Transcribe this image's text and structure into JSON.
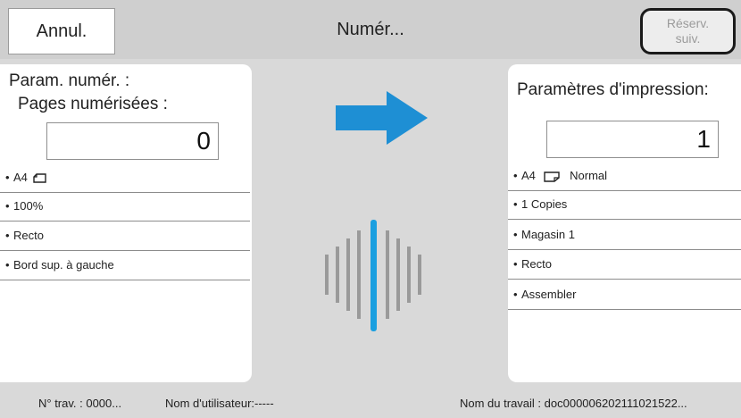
{
  "header": {
    "cancel_label": "Annul.",
    "title": "Numér...",
    "reserve_label": "Réserv.\nsuiv."
  },
  "scan_panel": {
    "title": "Param. numér. :",
    "subtitle": "Pages numérisées :",
    "count": "0",
    "items": [
      {
        "label": "A4",
        "icon": "landscape-page-icon"
      },
      {
        "label": "100%"
      },
      {
        "label": "Recto"
      },
      {
        "label": "Bord sup. à gauche"
      }
    ]
  },
  "print_panel": {
    "title": "Paramètres d'impression:",
    "count": "1",
    "items": [
      {
        "label": "A4",
        "icon": "portrait-page-icon",
        "suffix": "Normal"
      },
      {
        "label": "1 Copies"
      },
      {
        "label": "Magasin 1"
      },
      {
        "label": "Recto"
      },
      {
        "label": "Assembler"
      }
    ]
  },
  "status": {
    "accent_color": "#1a9fe0",
    "arrow_color": "#1e8fd4"
  },
  "footer": {
    "job_number": "N° trav. : 0000...",
    "user_name": "Nom d'utilisateur:-----",
    "job_name": "Nom du travail : doc000006202111021522..."
  }
}
